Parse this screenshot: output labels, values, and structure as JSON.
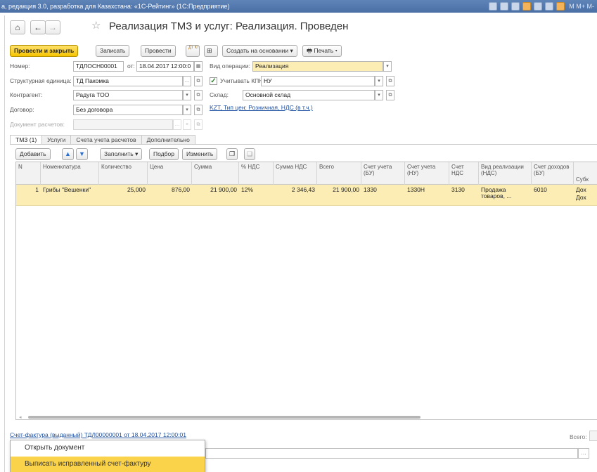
{
  "window": {
    "title": "а, редакция 3.0, разработка для Казахстана: «1С-Рейтинг» (1С:Предприятие)",
    "title_right": "M  M+  M-"
  },
  "header": {
    "home_icon": "⌂",
    "back_icon": "←",
    "forward_icon": "→",
    "star_icon": "☆",
    "title": "Реализация ТМЗ и услуг: Реализация. Проведен"
  },
  "toolbar": {
    "post_close": "Провести и закрыть",
    "save": "Записать",
    "post": "Провести",
    "dt_kt": "Дт Кт",
    "create_based": "Создать на основании ▾",
    "print": "🖶 Печать ▾"
  },
  "form": {
    "number_label": "Номер:",
    "number": "ТДЛОСН00001",
    "date_label": "от:",
    "date": "18.04.2017 12:00:0",
    "optype_label": "Вид операции:",
    "optype": "Реализация",
    "struct_label": "Структурная единица:",
    "struct": "ТД Пакомка",
    "kpn_label": "Учитывать КПН",
    "kpn": "НУ",
    "contractor_label": "Контрагент:",
    "contractor": "Радуга ТОО",
    "warehouse_label": "Склад:",
    "warehouse": "Основной склад",
    "contract_label": "Договор:",
    "contract": "Без договора",
    "price_link": "KZT, Тип цен: Розничная, НДС (в т.ч.)",
    "settlement_label": "Документ расчетов:"
  },
  "tabs": [
    "ТМЗ (1)",
    "Услуги",
    "Счета учета расчетов",
    "Дополнительно"
  ],
  "table_toolbar": {
    "add": "Добавить",
    "fill": "Заполнить ▾",
    "select": "Подбор",
    "change": "Изменить"
  },
  "table": {
    "headers": [
      "N",
      "Номенклатура",
      "Количество",
      "Цена",
      "Сумма",
      "% НДС",
      "Сумма НДС",
      "Всего",
      "Счет учета (БУ)",
      "Счет учета (НУ)",
      "Счет НДС",
      "Вид реализации (НДС)",
      "Счет доходов (БУ)",
      "Субк"
    ],
    "rows": [
      {
        "n": "1",
        "item": "Грибы \"Вешенки\"",
        "qty": "25,000",
        "price": "876,00",
        "sum": "21 900,00",
        "vat_rate": "12%",
        "vat_sum": "2 346,43",
        "total": "21 900,00",
        "acc_bu": "1330",
        "acc_nu": "1330Н",
        "acc_vat": "3130",
        "sale_type": "Продажа товаров, ...",
        "income_acc": "6010",
        "sub1": "Дох",
        "sub2": "Дох"
      }
    ]
  },
  "footer": {
    "invoice_link": "Счет-фактура (выданный) ТДЛ00000001 от 18.04.2017 12:00:01",
    "total_label": "Всего:"
  },
  "popup": {
    "items": [
      "Открыть документ",
      "Выписать исправленный счет-фактуру"
    ]
  }
}
